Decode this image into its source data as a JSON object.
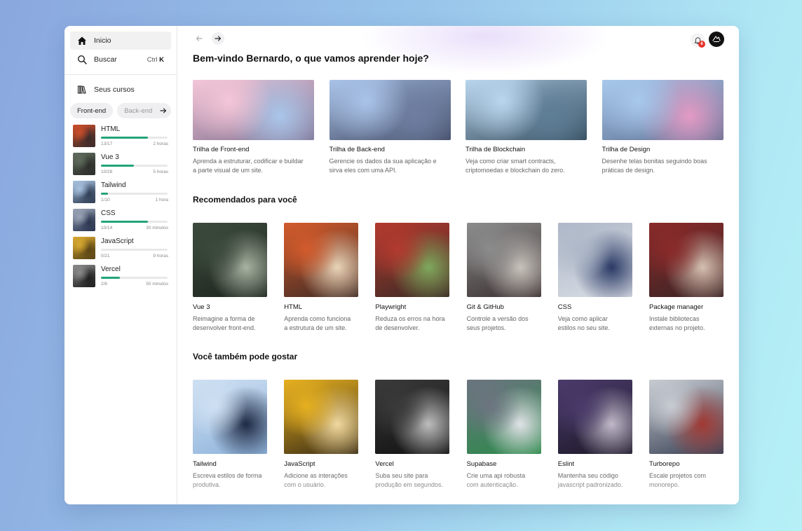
{
  "sidebar": {
    "nav": [
      {
        "label": "Inicio",
        "icon": "home-icon"
      },
      {
        "label": "Buscar",
        "icon": "search-icon",
        "shortcut_prefix": "Ctrl",
        "shortcut_key": "K"
      }
    ],
    "courses_label": "Seus cursos",
    "chips": [
      "Front-end",
      "Back-end"
    ],
    "courses": [
      {
        "name": "HTML",
        "progress": "13/17",
        "time": "2 horas",
        "fraction": 0.7,
        "colors": [
          "#c94d2a",
          "#3a2a2a"
        ]
      },
      {
        "name": "Vue 3",
        "progress": "10/28",
        "time": "5 horas",
        "fraction": 0.49,
        "colors": [
          "#5f6a5c",
          "#2b2f2a"
        ]
      },
      {
        "name": "Tailwind",
        "progress": "1/10",
        "time": "1 hora",
        "fraction": 0.1,
        "colors": [
          "#a8c2e0",
          "#2f3e55"
        ]
      },
      {
        "name": "CSS",
        "progress": "10/14",
        "time": "30 minutos",
        "fraction": 0.7,
        "colors": [
          "#9aa4b6",
          "#2a3550"
        ]
      },
      {
        "name": "JavaScript",
        "progress": "0/21",
        "time": "9 horas",
        "fraction": 0.0,
        "colors": [
          "#d8a830",
          "#5a4516"
        ]
      },
      {
        "name": "Vercel",
        "progress": "2/6",
        "time": "50 minutos",
        "fraction": 0.28,
        "colors": [
          "#8a8a8a",
          "#1f1f1f"
        ]
      }
    ]
  },
  "header": {
    "notification_count": "6"
  },
  "main": {
    "welcome": "Bem-vindo Bernardo, o que vamos aprender hoje?",
    "tracks": [
      {
        "title": "Trilha de Front-end",
        "desc1": "Aprenda a estruturar, codificar e buildar",
        "desc2": "a parte visual de um site.",
        "colors": [
          "#f4c6d8",
          "#a8c6ea",
          "#7a6a8a"
        ]
      },
      {
        "title": "Trilha de Back-end",
        "desc1": "Gerencie os dados da sua aplicação e",
        "desc2": "sirva eles com uma API.",
        "colors": [
          "#a9c3e8",
          "#6e7ea0",
          "#3f4660"
        ]
      },
      {
        "title": "Trilha de Blockchain",
        "desc1": "Veja como criar smart contracts,",
        "desc2": "criptomoedas e blockchain do zero.",
        "colors": [
          "#b9d6ee",
          "#5d7e96",
          "#2f4455"
        ]
      },
      {
        "title": "Trilha de Design",
        "desc1": "Desenhe telas bonitas seguindo boas",
        "desc2": "práticas de design.",
        "colors": [
          "#a8c8ec",
          "#e49ac4",
          "#566a8c"
        ]
      }
    ],
    "recommended_title": "Recomendados para você",
    "recommended": [
      {
        "title": "Vue 3",
        "desc1": "Reimagine a forma de",
        "desc2": "desenvolver front-end.",
        "colors": [
          "#3b4a3c",
          "#a7b2a1",
          "#1f261f"
        ]
      },
      {
        "title": "HTML",
        "desc1": "Aprenda como funciona",
        "desc2": "a estrutura de um site.",
        "colors": [
          "#d25b2c",
          "#e8d4b8",
          "#3e2a24"
        ]
      },
      {
        "title": "Playwright",
        "desc1": "Reduza os erros na hora",
        "desc2": "de desenvolver.",
        "colors": [
          "#b33a2f",
          "#7ea85c",
          "#3a2a24"
        ]
      },
      {
        "title": "Git & GitHub",
        "desc1": "Controle a versão dos",
        "desc2": "seus projetos.",
        "colors": [
          "#8c8c8c",
          "#c8c2bc",
          "#3a3030"
        ]
      },
      {
        "title": "CSS",
        "desc1": "Veja como aplicar",
        "desc2": "estilos no seu site.",
        "colors": [
          "#aeb8c8",
          "#2b3a66",
          "#d8dce4"
        ]
      },
      {
        "title": "Package manager",
        "desc1": "Instale bibliotecas",
        "desc2": "externas no projeto.",
        "colors": [
          "#8a2a2a",
          "#d4c0b0",
          "#3a2424"
        ]
      }
    ],
    "also_title": "Você também pode gostar",
    "also": [
      {
        "title": "Tailwind",
        "desc1": "Escreva estilos de forma",
        "desc2": "produtiva.",
        "colors": [
          "#cfe0f2",
          "#1f2a44",
          "#8fb4dc"
        ]
      },
      {
        "title": "JavaScript",
        "desc1": "Adicione as interações",
        "desc2": "com o usuário.",
        "colors": [
          "#e6b020",
          "#f0d8a0",
          "#3a2c14"
        ]
      },
      {
        "title": "Vercel",
        "desc1": "Suba seu site para",
        "desc2": "produção em segundos.",
        "colors": [
          "#3a3a3a",
          "#bdbdbd",
          "#111111"
        ]
      },
      {
        "title": "Supabase",
        "desc1": "Crie uma api robusta",
        "desc2": "com autenticação.",
        "colors": [
          "#6c7480",
          "#e0e2e6",
          "#2b8a4a"
        ]
      },
      {
        "title": "Eslint",
        "desc1": "Mantenha seu código",
        "desc2": "javascript padronizado.",
        "colors": [
          "#4a3a6a",
          "#c0b8c8",
          "#1e1a2a"
        ]
      },
      {
        "title": "Turborepo",
        "desc1": "Escale projetos com",
        "desc2": "monorepo.",
        "colors": [
          "#c8ccd2",
          "#a23a34",
          "#3a4256"
        ]
      }
    ]
  }
}
